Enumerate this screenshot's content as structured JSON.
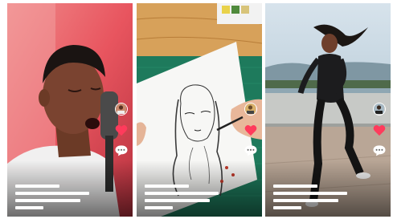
{
  "feed": {
    "cards": [
      {
        "scene": "singer-at-microphone",
        "icons": [
          "avatar-icon",
          "heart-icon",
          "comment-icon"
        ],
        "caption_lines": 4,
        "liked": true
      },
      {
        "scene": "pencil-portrait-sketch",
        "icons": [
          "avatar-icon",
          "heart-icon",
          "comment-icon"
        ],
        "caption_lines": 4,
        "liked": true
      },
      {
        "scene": "dancer-on-pier",
        "icons": [
          "avatar-icon",
          "heart-icon",
          "comment-icon"
        ],
        "caption_lines": 4,
        "liked": true
      }
    ]
  },
  "colors": {
    "heart": "#ff3b5c",
    "caption_placeholder": "#ffffff",
    "card1_background": "#e8555f",
    "card2_background": "#d7a15a",
    "card3_background": "#b9cedb"
  }
}
